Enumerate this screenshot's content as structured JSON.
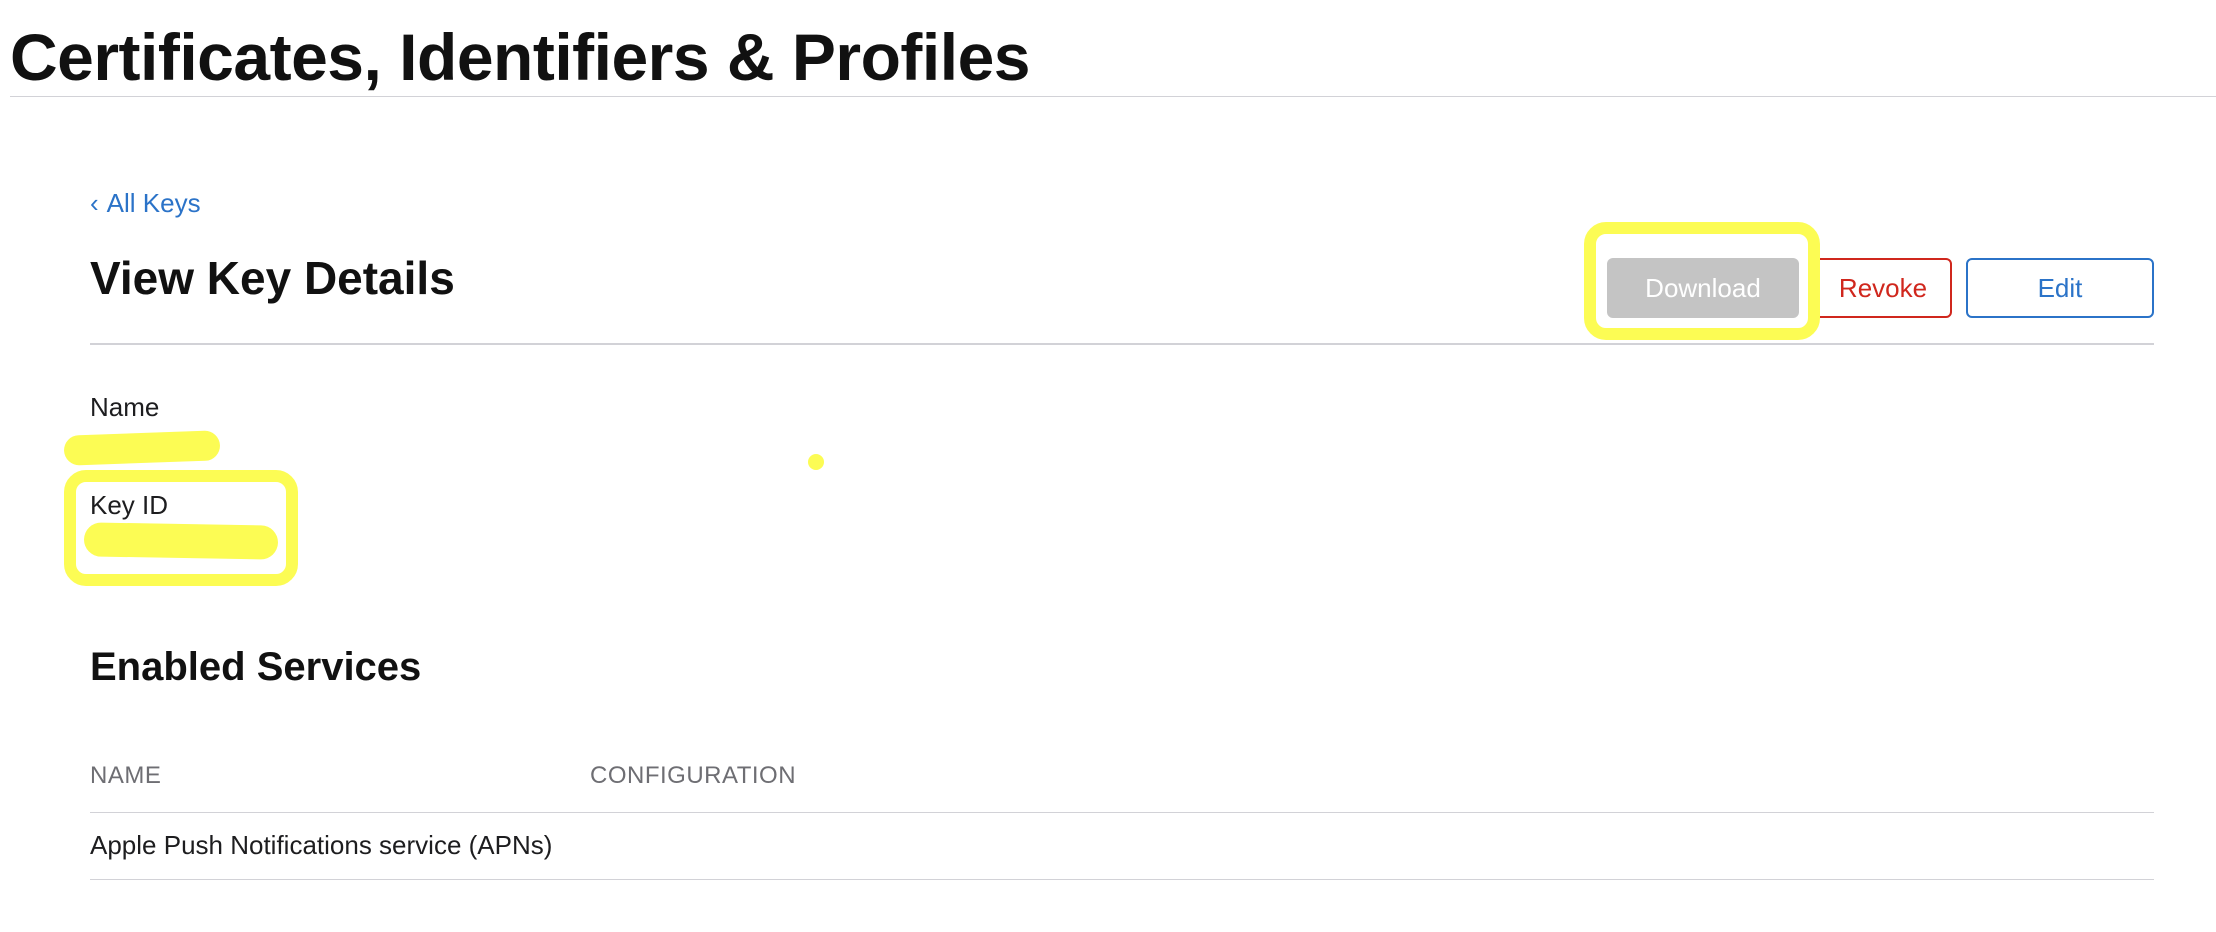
{
  "site": {
    "title": "Certificates, Identifiers & Profiles"
  },
  "nav": {
    "back_chevron": "‹",
    "back_label": "All Keys"
  },
  "key_details": {
    "heading": "View Key Details",
    "actions": {
      "download_label": "Download",
      "revoke_label": "Revoke",
      "edit_label": "Edit"
    },
    "fields": {
      "name_label": "Name",
      "key_id_label": "Key ID"
    }
  },
  "services": {
    "heading": "Enabled Services",
    "columns": [
      "NAME",
      "CONFIGURATION"
    ],
    "rows": [
      {
        "name": "Apple Push Notifications service (APNs)",
        "configuration": ""
      }
    ]
  },
  "colors": {
    "accent_link": "#2b73c8",
    "revoke_red": "#d0271d",
    "disabled_button": "#c4c4c4",
    "annotation_highlight": "#fcfc54"
  }
}
